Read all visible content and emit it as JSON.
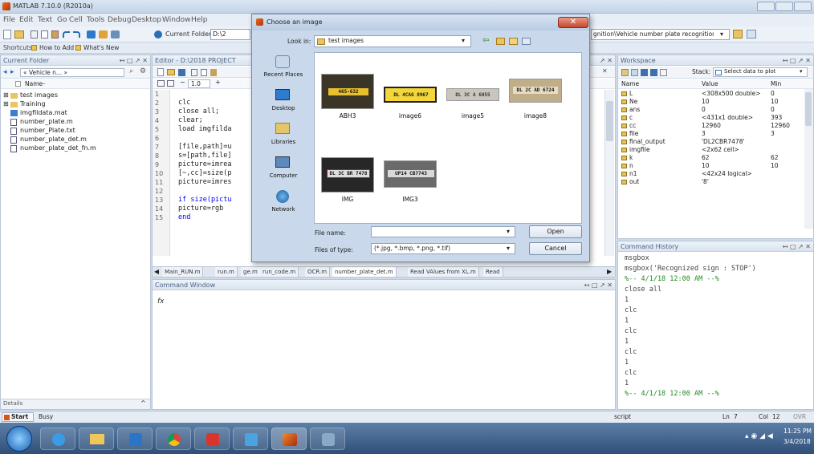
{
  "app": {
    "title": "MATLAB 7.10.0 (R2010a)",
    "menu": [
      "File",
      "Edit",
      "Text",
      "Go",
      "Cell",
      "Tools",
      "Debug",
      "Desktop",
      "Window",
      "Help"
    ],
    "current_folder_label": "Current Folder:",
    "current_folder_value": "D:\\2",
    "path_tail": "gnition\\Vehicle number plate recognition",
    "shortcuts": [
      "Shortcuts",
      "How to Add",
      "What's New"
    ]
  },
  "current_folder_panel": {
    "title": "Current Folder",
    "path": "« Vehicle n... »",
    "column": "Name",
    "items": [
      "test images",
      "Training",
      "imgfildata.mat",
      "number_plate.m",
      "number_Plate.txt",
      "number_plate_det.m",
      "number_plate_det_fn.m"
    ],
    "details": "Details"
  },
  "editor": {
    "title": "Editor - D:\\2018 PROJECT",
    "zoom": "1.0",
    "lines": [
      {
        "n": "1",
        "code": ""
      },
      {
        "n": "2",
        "code": "clc"
      },
      {
        "n": "3",
        "code": "close all;"
      },
      {
        "n": "4",
        "code": "clear;"
      },
      {
        "n": "5",
        "code": "load imgfilda"
      },
      {
        "n": "6",
        "code": ""
      },
      {
        "n": "7",
        "code": "[file,path]=u"
      },
      {
        "n": "8",
        "code": "s=[path,file]"
      },
      {
        "n": "9",
        "code": "picture=imrea"
      },
      {
        "n": "10",
        "code": "[~,cc]=size(p"
      },
      {
        "n": "11",
        "code": "picture=imres"
      },
      {
        "n": "12",
        "code": ""
      },
      {
        "n": "13",
        "code": "if size(pictu"
      },
      {
        "n": "14",
        "code": "   picture=rgb"
      },
      {
        "n": "15",
        "code": "end"
      }
    ],
    "tabs": [
      "Main_RUN.m",
      "run.m",
      "ge.m",
      "run_code.m",
      "OCR.m",
      "number_plate_det.m",
      "Read VAlues from XL.m",
      "Read"
    ]
  },
  "command_window": {
    "title": "Command Window",
    "prompt": "fx"
  },
  "workspace": {
    "title": "Workspace",
    "stack_label": "Stack:",
    "select_plot": "Select data to plot",
    "columns": [
      "Name",
      "Value",
      "Min"
    ],
    "rows": [
      {
        "name": "L",
        "value": "<308x500 double>",
        "min": "0"
      },
      {
        "name": "Ne",
        "value": "10",
        "min": "10"
      },
      {
        "name": "ans",
        "value": "0",
        "min": "0"
      },
      {
        "name": "c",
        "value": "<431x1 double>",
        "min": "393"
      },
      {
        "name": "cc",
        "value": "12960",
        "min": "12960"
      },
      {
        "name": "file",
        "value": "3",
        "min": "3"
      },
      {
        "name": "final_output",
        "value": "'DL2CBR7478'",
        "min": ""
      },
      {
        "name": "imgfile",
        "value": "<2x62 cell>",
        "min": ""
      },
      {
        "name": "k",
        "value": "62",
        "min": "62"
      },
      {
        "name": "n",
        "value": "10",
        "min": "10"
      },
      {
        "name": "n1",
        "value": "<42x24 logical>",
        "min": ""
      },
      {
        "name": "out",
        "value": "'8'",
        "min": ""
      }
    ]
  },
  "command_history": {
    "title": "Command History",
    "lines": [
      "msgbox",
      "msgbox('Recognized sign : STOP')",
      "%-- 4/1/18 12:00 AM --%",
      "close all",
      "1",
      "clc",
      "1",
      "clc",
      "1",
      "clc",
      "1",
      "clc",
      "1",
      "%-- 4/1/18 12:00 AM --%"
    ]
  },
  "dialog": {
    "title": "Choose an image",
    "look_in_label": "Look in:",
    "look_in_value": "test images",
    "places": [
      "Recent Places",
      "Desktop",
      "Libraries",
      "Computer",
      "Network"
    ],
    "files": [
      {
        "label": "ABH3",
        "plate": "465-632"
      },
      {
        "label": "image6",
        "plate": "DL 4CAG 8967"
      },
      {
        "label": "image5",
        "plate": "DL 3C A 6055"
      },
      {
        "label": "image8",
        "plate": "DL 2C AD 6724"
      },
      {
        "label": "IMG",
        "plate": "DL 3C BR 7478"
      },
      {
        "label": "IMG3",
        "plate": "UP14 CB7743"
      }
    ],
    "filename_label": "File name:",
    "filename_value": "",
    "filetype_label": "Files of type:",
    "filetype_value": "(*.jpg, *.bmp, *.png, *.tif)",
    "open": "Open",
    "cancel": "Cancel"
  },
  "status": {
    "start": "Start",
    "state": "Busy",
    "mode": "script",
    "ln_label": "Ln",
    "ln": "7",
    "col_label": "Col",
    "col": "12",
    "ovr": "OVR"
  },
  "taskbar": {
    "time": "11:25 PM",
    "date": "3/4/2018"
  },
  "colors": {
    "matlab_keyword": "#0000ff",
    "comment": "#228b22",
    "window_chrome": "#c9d8ea",
    "close_button": "#c7452d"
  }
}
